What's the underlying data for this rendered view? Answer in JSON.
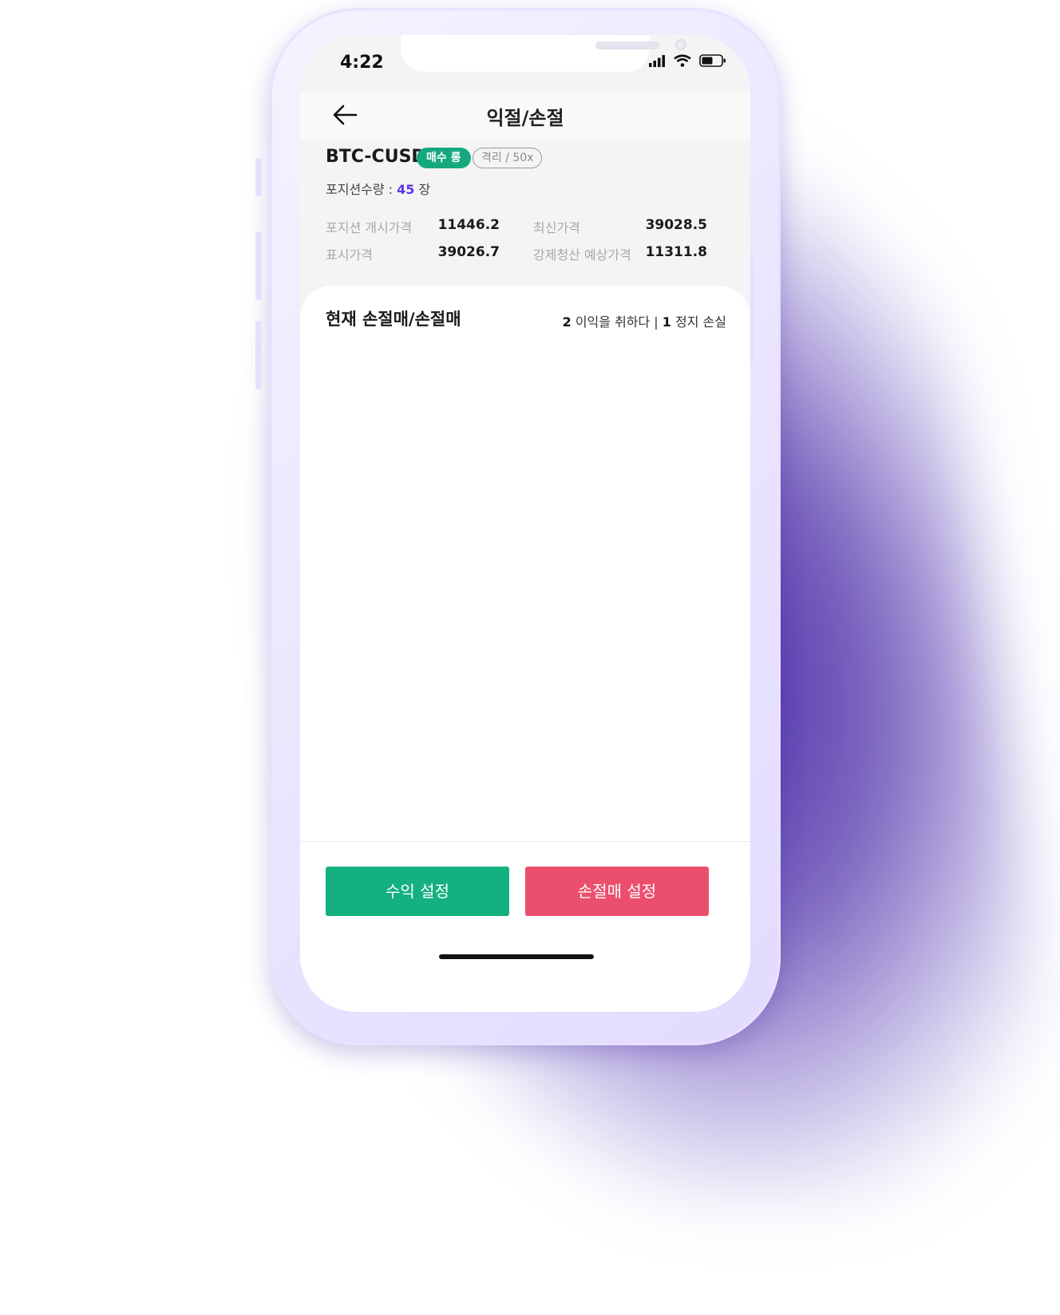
{
  "status_bar": {
    "time": "4:22",
    "icons": [
      "signal-icon",
      "wifi-icon",
      "battery-icon"
    ]
  },
  "header": {
    "title": "익절/손절",
    "back_icon": "arrow-left-icon"
  },
  "position": {
    "pair": "BTC-CUSD",
    "side_badge": "매수 롱",
    "margin_badge": "격리 / 50x",
    "quantity_label": "포지션수량 : ",
    "quantity_value": "45",
    "quantity_unit": " 장",
    "entry_price_label": "포지션 개시가격",
    "entry_price_value": "11446.2",
    "latest_price_label": "최신가격",
    "latest_price_value": "39028.5",
    "mark_price_label": "표시가격",
    "mark_price_value": "39026.7",
    "liq_price_label": "강제청산 예상가격",
    "liq_price_value": "11311.8"
  },
  "orders": {
    "title": "현재 손절매/손절매",
    "tp_count": "2",
    "tp_label": " 이익을 취하다 | ",
    "sl_count": "1",
    "sl_label": " 정지 손실"
  },
  "actions": {
    "profit_button": "수익 설정",
    "loss_button": "손절매 설정"
  },
  "colors": {
    "accent_green": "#15b07f",
    "accent_red": "#ec4f6d",
    "accent_purple": "#5b35e6"
  }
}
